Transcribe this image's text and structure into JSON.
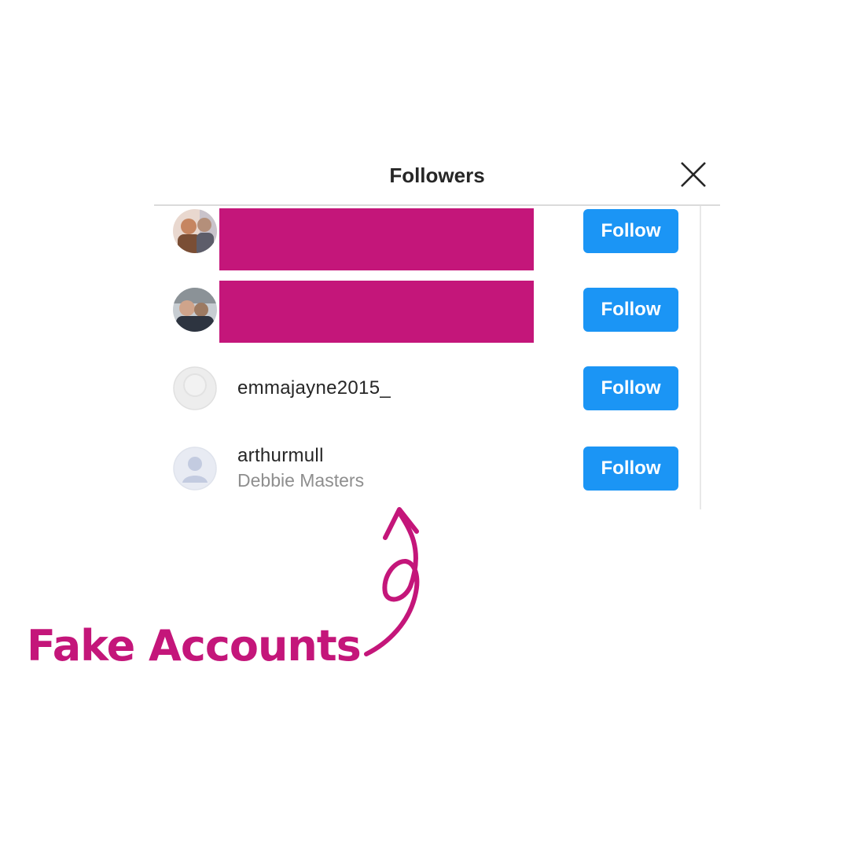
{
  "dialog": {
    "title": "Followers",
    "close_icon": "close-icon"
  },
  "followers": [
    {
      "username": "",
      "full_name": "",
      "avatar": "photo",
      "redacted": true,
      "follow_label": "Follow"
    },
    {
      "username": "",
      "full_name": "",
      "avatar": "photo",
      "redacted": true,
      "follow_label": "Follow"
    },
    {
      "username": "emmajayne2015_",
      "full_name": "",
      "avatar": "default-avatar",
      "redacted": false,
      "follow_label": "Follow"
    },
    {
      "username": "arthurmull",
      "full_name": "Debbie Masters",
      "avatar": "default-avatar",
      "redacted": false,
      "follow_label": "Follow"
    }
  ],
  "annotation": {
    "label": "Fake Accounts",
    "arrow_icon": "curly-arrow-icon"
  },
  "colors": {
    "accent": "#c4167a",
    "follow_button": "#1b95f5",
    "username_text": "#262626",
    "secondary_text": "#8e8e8e",
    "divider": "#dbdbdb"
  }
}
